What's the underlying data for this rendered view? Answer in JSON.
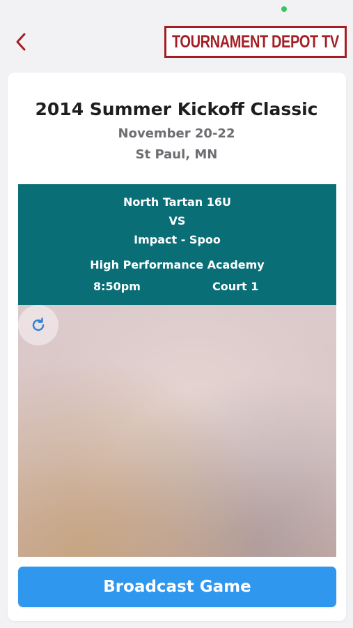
{
  "header": {
    "back_icon": "chevron-left-icon",
    "logo_text": "TOURNAMENT DEPOT TV",
    "brand_color": "#a41f25"
  },
  "event": {
    "title": "2014 Summer Kickoff Classic",
    "dates": "November 20-22",
    "location": "St Paul, MN"
  },
  "game": {
    "team1": "North Tartan 16U",
    "vs": "VS",
    "team2": "Impact - Spoo",
    "venue": "High Performance Academy",
    "time": "8:50pm",
    "court": "Court 1",
    "banner_color": "#0a6e77"
  },
  "video": {
    "refresh_icon": "refresh-icon"
  },
  "actions": {
    "broadcast_label": "Broadcast Game",
    "broadcast_color": "#2f97ee"
  }
}
